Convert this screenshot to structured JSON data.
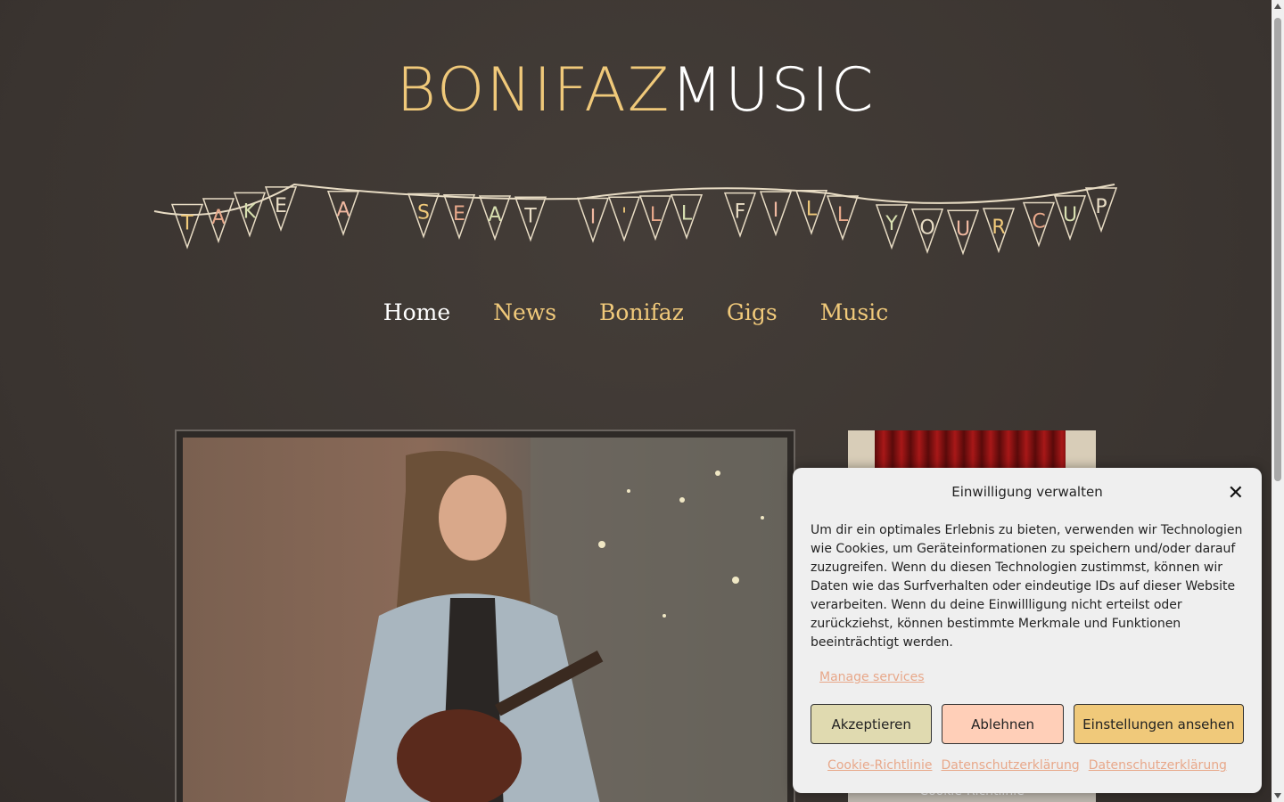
{
  "logo": {
    "part1": "BONIFAZ",
    "part2": "MUSIC"
  },
  "banner": {
    "letters": [
      "T",
      "A",
      "K",
      "E",
      "A",
      "S",
      "E",
      "A",
      "T",
      "I",
      "'",
      "L",
      "L",
      "F",
      "I",
      "L",
      "L",
      "Y",
      "O",
      "U",
      "R",
      "C",
      "U",
      "P"
    ]
  },
  "nav": {
    "items": [
      {
        "label": "Home",
        "active": true
      },
      {
        "label": "News"
      },
      {
        "label": "Bonifaz"
      },
      {
        "label": "Gigs"
      },
      {
        "label": "Music"
      }
    ]
  },
  "sidebar": {
    "bottom_link": "Cookie-Richtlinie"
  },
  "cookie": {
    "title": "Einwilligung verwalten",
    "message": "Um dir ein optimales Erlebnis zu bieten, verwenden wir Technologien wie Cookies, um Geräteinformationen zu speichern und/oder darauf zuzugreifen. Wenn du diesen Technologien zustimmst, können wir Daten wie das Surfverhalten oder eindeutige IDs auf dieser Website verarbeiten. Wenn du deine Einwillligung nicht erteilst oder zurückziehst, können bestimmte Merkmale und Funktionen beeinträchtigt werden.",
    "manage": "Manage services",
    "accept": "Akzeptieren",
    "deny": "Ablehnen",
    "settings": "Einstellungen ansehen",
    "links": [
      "Cookie-Richtlinie",
      "Datenschutzerklärung",
      "Datenschutzerklärung"
    ]
  },
  "colors": {
    "accent": "#f0c97a",
    "background": "#3e3834",
    "link": "#e8a88a"
  }
}
